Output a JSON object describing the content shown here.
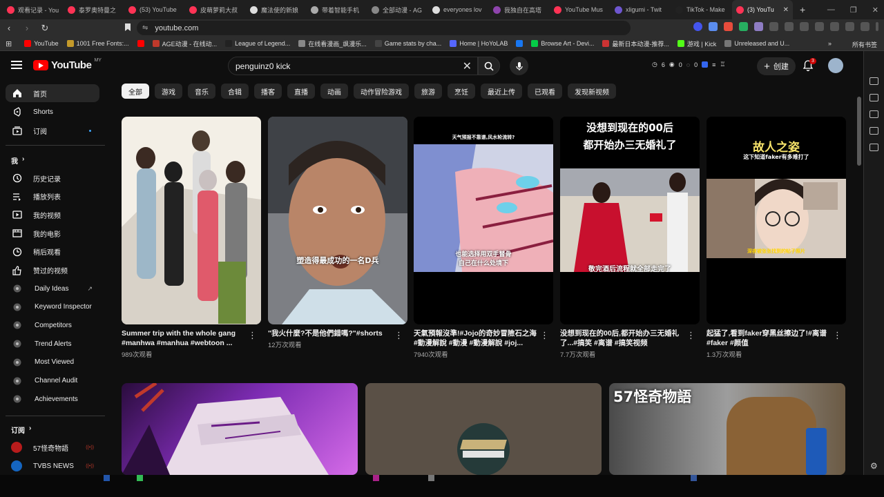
{
  "browser": {
    "tabs": [
      {
        "title": "观看记录 - You",
        "color": "#ff3355"
      },
      {
        "title": "泰罗奥特曼之",
        "color": "#ff3355"
      },
      {
        "title": "(53) YouTube",
        "color": "#ff3355"
      },
      {
        "title": "皮萌萝莉大叔",
        "color": "#ff3355"
      },
      {
        "title": "魔法使的新娘",
        "color": "#dddddd"
      },
      {
        "title": "带着智能手机",
        "color": "#aaaaaa"
      },
      {
        "title": "全部动漫 - AG",
        "color": "#888888"
      },
      {
        "title": "everyones lov",
        "color": "#dddddd"
      },
      {
        "title": "我独自在高塔",
        "color": "#8e44ad"
      },
      {
        "title": "YouTube Mus",
        "color": "#ff3355"
      },
      {
        "title": "xligumi - Twit",
        "color": "#6e56cf"
      },
      {
        "title": "TikTok - Make",
        "color": "#222222"
      },
      {
        "title": "(3) YouTu",
        "color": "#ff3355"
      }
    ],
    "new_tab": "+",
    "url": "youtube.com",
    "bookmarks": [
      {
        "label": "YouTube",
        "color": "#ff0000"
      },
      {
        "label": "1001 Free Fonts:...",
        "color": "#c49a2a"
      },
      {
        "label": "",
        "color": "#ff0000"
      },
      {
        "label": "AGE动漫 - 在线动...",
        "color": "#c0392b"
      },
      {
        "label": "League of Legend...",
        "color": "#222222"
      },
      {
        "label": "在线看漫画_飒漫乐...",
        "color": "#888888"
      },
      {
        "label": "Game stats by cha...",
        "color": "#444444"
      },
      {
        "label": "Home | HoYoLAB",
        "color": "#5566ff"
      },
      {
        "label": "",
        "color": "#1877f2"
      },
      {
        "label": "Browse Art - Devi...",
        "color": "#05cc47"
      },
      {
        "label": "最新日本动漫-推荐...",
        "color": "#cc3333"
      },
      {
        "label": "游戏 | Kick",
        "color": "#53fc18"
      },
      {
        "label": "Unreleased and U...",
        "color": "#777777"
      }
    ],
    "all_bookmarks": "所有书签"
  },
  "header": {
    "logo_text": "YouTube",
    "region": "MY",
    "search_value": "penguinz0 kick",
    "stats": [
      "6",
      "0",
      "0"
    ],
    "create_label": "创建",
    "notif_count": "3"
  },
  "sidebar": {
    "main": [
      {
        "label": "首页",
        "icon": "home-icon"
      },
      {
        "label": "Shorts",
        "icon": "shorts-icon"
      },
      {
        "label": "订阅",
        "icon": "subscriptions-icon"
      }
    ],
    "you_heading": "我",
    "you": [
      {
        "label": "历史记录",
        "icon": "history-icon"
      },
      {
        "label": "播放列表",
        "icon": "playlist-icon"
      },
      {
        "label": "我的视频",
        "icon": "my-videos-icon"
      },
      {
        "label": "我的电影",
        "icon": "movies-icon"
      },
      {
        "label": "稍后观看",
        "icon": "watch-later-icon"
      },
      {
        "label": "赞过的视频",
        "icon": "like-icon"
      }
    ],
    "tools": [
      "Daily Ideas",
      "Keyword Inspector",
      "Competitors",
      "Trend Alerts",
      "Most Viewed",
      "Channel Audit",
      "Achievements"
    ],
    "subs_heading": "订阅",
    "subs": [
      {
        "label": "57怪奇物語",
        "color": "#b71c1c"
      },
      {
        "label": "TVBS NEWS",
        "color": "#1565c0"
      }
    ]
  },
  "chips": [
    "全部",
    "游戏",
    "音乐",
    "合辑",
    "播客",
    "直播",
    "动画",
    "动作冒险游戏",
    "旅游",
    "烹饪",
    "最近上传",
    "已观看",
    "发现新视频"
  ],
  "videos": [
    {
      "title": "Summer trip with the whole gang #manhwa #manhua #webtoon ...",
      "views": "989次观看"
    },
    {
      "title": "\"我火什麼?不是他們錯嗎?\"#shorts",
      "views": "12万次观看"
    },
    {
      "title": "天氣預報沒準!#Jojo的奇妙冒險石之海 #動漫解說 #動漫 #動漫解說 #joj...",
      "views": "7940次观看"
    },
    {
      "title": "没想到现在的00后,都开始办三无婚礼了...#搞笑 #离谱 #搞笑视频",
      "views": "7.7万次观看"
    },
    {
      "title": "起猛了,看到faker穿黑丝擦边了!#离谱 #faker #颜值",
      "views": "1.3万次观看"
    }
  ],
  "overlays": {
    "v2": "塑造得最成功的一名D兵",
    "v3_top": "天气预报不靠谱,风水轮流转?",
    "v3_sub": "也能选择用双手替骨\n自己在什么处境下",
    "v4_top": "没想到现在的00后\n都开始办三无婚礼了",
    "v4_sub": "敬完酒后流程就全部走完了",
    "v5_top": "故人之姿",
    "v5_sub": "这下知道faker有多难打了",
    "v5_bottom": "深夜被张张找到的帖子照片",
    "b3_top": "57怪奇物語"
  }
}
